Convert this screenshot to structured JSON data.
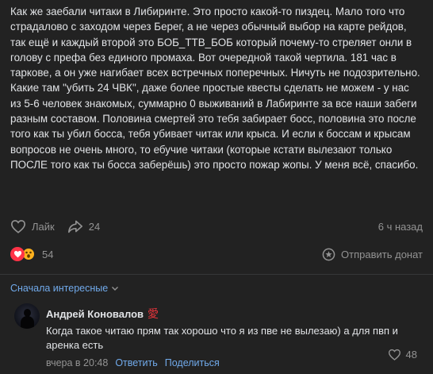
{
  "post": {
    "paragraphs": [
      "Как же заебали читаки в Либиринте. Это просто какой-то пиздец. Мало того что страдалово с заходом через Берег, а не через обычный выбор на карте рейдов, так ещё и каждый второй это БОБ_ТТВ_БОБ который почему-то стреляет онли в голову с префа без единого промаха. Вот очередной такой чертила. 181 час в таркове, а он уже нагибает всех встречных поперечных. Ничуть не подозрительно.",
      "Какие там \"убить 24 ЧВК\", даже более простые квесты сделать не можем - у нас из 5-6 человек знакомых, суммарно 0 выживаний в Лабиринте за все наши забеги разным составом. Половина смертей это тебя забирает босс, половина это после того как ты убил босса, тебя убивает читак или крыса. И если к боссам и крысам вопросов не очень много, то ебучие читаки (которые кстати вылезают только ПОСЛЕ того как ты босса заберёшь) это просто пожар жопы. У меня всё, спасибо."
    ]
  },
  "actions": {
    "like_label": "Лайк",
    "share_count": "24",
    "time": "6 ч назад"
  },
  "reactions": {
    "count": "54",
    "donate_label": "Отправить донат"
  },
  "comments": {
    "sort_label": "Сначала интересные",
    "items": [
      {
        "author": "Андрей Коновалов",
        "badge": "愛",
        "text": "Когда такое читаю прям так хорошо что я из пве не вылезаю) а для пвп и аренка есть",
        "time": "вчера в 20:48",
        "reply_label": "Ответить",
        "share_label": "Поделиться",
        "likes": "48"
      }
    ]
  },
  "colors": {
    "background": "#222222",
    "text": "#e1e3e6",
    "muted": "#939393",
    "link": "#71aaeb",
    "heart": "#ff3347"
  }
}
